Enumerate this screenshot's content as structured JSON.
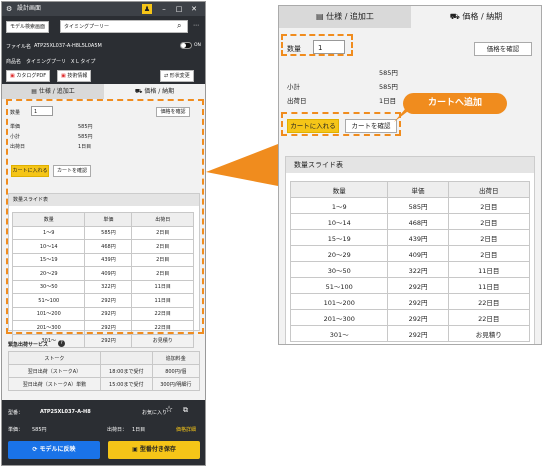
{
  "left": {
    "window_title": "設計画面",
    "search": {
      "tag_model": "モデル検索画面",
      "query": "タイミングプーリー"
    },
    "file": {
      "label": "ファイル名",
      "value": "ATP25XL037-A-H8L5L0A5M",
      "toggle_label": "ON"
    },
    "product": {
      "label": "商品名",
      "value": "タイミングプーリ　X L タイプ"
    },
    "links": {
      "catalog": "カタログPDF",
      "tech": "技術情報",
      "shape_change": "形状変更"
    },
    "tabs": {
      "spec": "仕様 / 追加工",
      "price": "価格 / 納期"
    },
    "form": {
      "qty_label": "数量",
      "qty_value": "1",
      "confirm_price": "価格を確認",
      "unit_price_label": "単価",
      "unit_price_value": "585円",
      "subtotal_label": "小計",
      "subtotal_value": "585円",
      "ship_label": "出荷日",
      "ship_value": "1日目",
      "add_cart": "カートに入れる",
      "view_cart": "カートを確認"
    },
    "slide": {
      "title": "数量スライド表",
      "headers": [
        "数量",
        "単価",
        "出荷日"
      ],
      "rows": [
        [
          "1〜9",
          "585円",
          "2日目"
        ],
        [
          "10〜14",
          "468円",
          "2日目"
        ],
        [
          "15〜19",
          "439円",
          "2日目"
        ],
        [
          "20〜29",
          "409円",
          "2日目"
        ],
        [
          "30〜50",
          "322円",
          "11日目"
        ],
        [
          "51〜100",
          "292円",
          "11日目"
        ],
        [
          "101〜200",
          "292円",
          "22日目"
        ],
        [
          "201〜300",
          "292円",
          "22日目"
        ],
        [
          "301〜",
          "292円",
          "お見積り"
        ]
      ]
    },
    "express": {
      "title": "緊急出荷サービス",
      "headers": [
        "ストーク",
        "",
        "追加料金"
      ],
      "rows": [
        [
          "翌日出荷（ストークA）",
          "18:00まで受付",
          "800円/個"
        ],
        [
          "翌日出荷（ストークA）単數",
          "15:00まで受付",
          "300円/明細行"
        ]
      ]
    },
    "footer": {
      "model_label": "型番：",
      "model_value": "ATP25XL037-A-H8",
      "favorite": "お気に入り",
      "unit_label": "単価：",
      "unit_value": "585円",
      "ship_label": "出荷日：",
      "ship_value": "1日目",
      "detail": "価格詳細",
      "reflect_btn": "モデルに反映",
      "save_btn": "型番付き保存"
    }
  },
  "zoom": {
    "tabs": {
      "spec": "仕様 / 追加工",
      "price": "価格 / 納期"
    },
    "form": {
      "qty_label": "数量",
      "qty_value": "1",
      "confirm_price": "価格を確認",
      "unit_price_value": "585円",
      "subtotal_label": "小計",
      "subtotal_value": "585円",
      "ship_label": "出荷日",
      "ship_value": "1日目",
      "add_cart": "カートに入れる",
      "view_cart": "カートを確認"
    },
    "slide": {
      "title": "数量スライド表",
      "headers": [
        "数量",
        "単価",
        "出荷日"
      ],
      "rows": [
        [
          "1〜9",
          "585円",
          "2日目"
        ],
        [
          "10〜14",
          "468円",
          "2日目"
        ],
        [
          "15〜19",
          "439円",
          "2日目"
        ],
        [
          "20〜29",
          "409円",
          "2日目"
        ],
        [
          "30〜50",
          "322円",
          "11日目"
        ],
        [
          "51〜100",
          "292円",
          "11日目"
        ],
        [
          "101〜200",
          "292円",
          "22日目"
        ],
        [
          "201〜300",
          "292円",
          "22日目"
        ],
        [
          "301〜",
          "292円",
          "お見積り"
        ]
      ]
    }
  },
  "callout": "カートへ追加",
  "colors": {
    "accent_orange": "#f08c1e",
    "yellow": "#f5c518",
    "blue": "#1a73e8",
    "dark": "#2b2e33"
  }
}
